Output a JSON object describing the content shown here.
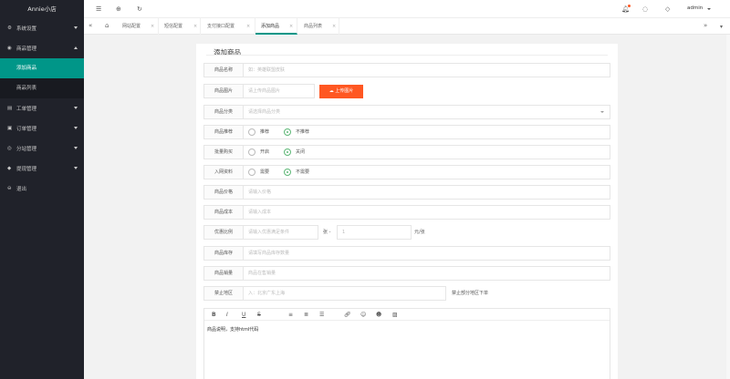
{
  "app": {
    "title": "Annie小店"
  },
  "sidebar": {
    "items": [
      {
        "label": "系统设置",
        "icon": "⚙"
      },
      {
        "label": "商品管理",
        "icon": "◉"
      },
      {
        "label": "工单管理",
        "icon": "▤"
      },
      {
        "label": "订单管理",
        "icon": "▣"
      },
      {
        "label": "分站管理",
        "icon": "◎"
      },
      {
        "label": "提现管理",
        "icon": "◆"
      },
      {
        "label": "退出",
        "icon": "⊖"
      }
    ],
    "submenu": [
      {
        "label": "添加商品"
      },
      {
        "label": "商品列表"
      }
    ]
  },
  "header": {
    "icons": {
      "menu": "☰",
      "globe": "⊕",
      "refresh": "↻",
      "bell": "🔔︎",
      "chat": "◌",
      "skin": "◇"
    },
    "admin": "admin"
  },
  "tabs": {
    "prev": "«",
    "home": "⌂",
    "next": "»",
    "close": "×",
    "items": [
      {
        "label": "网站配置"
      },
      {
        "label": "短信配置"
      },
      {
        "label": "支付接口配置"
      },
      {
        "label": "添加商品"
      },
      {
        "label": "商品列表"
      }
    ]
  },
  "form": {
    "title": "添加商品",
    "name": {
      "label": "商品名称",
      "placeholder": "如：英雄联盟皮肤"
    },
    "image": {
      "label": "商品图片",
      "placeholder": "请上传商品图片",
      "button": "上传图片"
    },
    "category": {
      "label": "商品分类",
      "placeholder": "请选择商品分类"
    },
    "recommend": {
      "label": "商品推荐",
      "opt1": "推荐",
      "opt2": "不推荐"
    },
    "batch": {
      "label": "批量购买",
      "opt1": "开启",
      "opt2": "关闭"
    },
    "info": {
      "label": "入网资料",
      "opt1": "需要",
      "opt2": "不需要"
    },
    "price": {
      "label": "商品价格",
      "placeholder": "请输入价格"
    },
    "cost": {
      "label": "商品成本",
      "placeholder": "请输入成本"
    },
    "discount": {
      "label": "优惠比例",
      "placeholder": "请输入优惠满足条件",
      "mid": "张 -",
      "placeholder2": "1",
      "unit": "元/张"
    },
    "stock": {
      "label": "商品库存",
      "placeholder": "请填写商品库存数量"
    },
    "sales": {
      "label": "商品销量",
      "placeholder": "商品在售销量"
    },
    "region": {
      "label": "禁止地区",
      "placeholder": "入：北京广东上海",
      "hint": "禁止部分地区下单"
    }
  },
  "editor": {
    "toolbar": [
      "B",
      "I",
      "U",
      "S",
      "≡",
      "≣",
      "☰",
      "🔗︎",
      "☺",
      "☻",
      "▨"
    ],
    "content": "商品说明，支持html代码"
  }
}
